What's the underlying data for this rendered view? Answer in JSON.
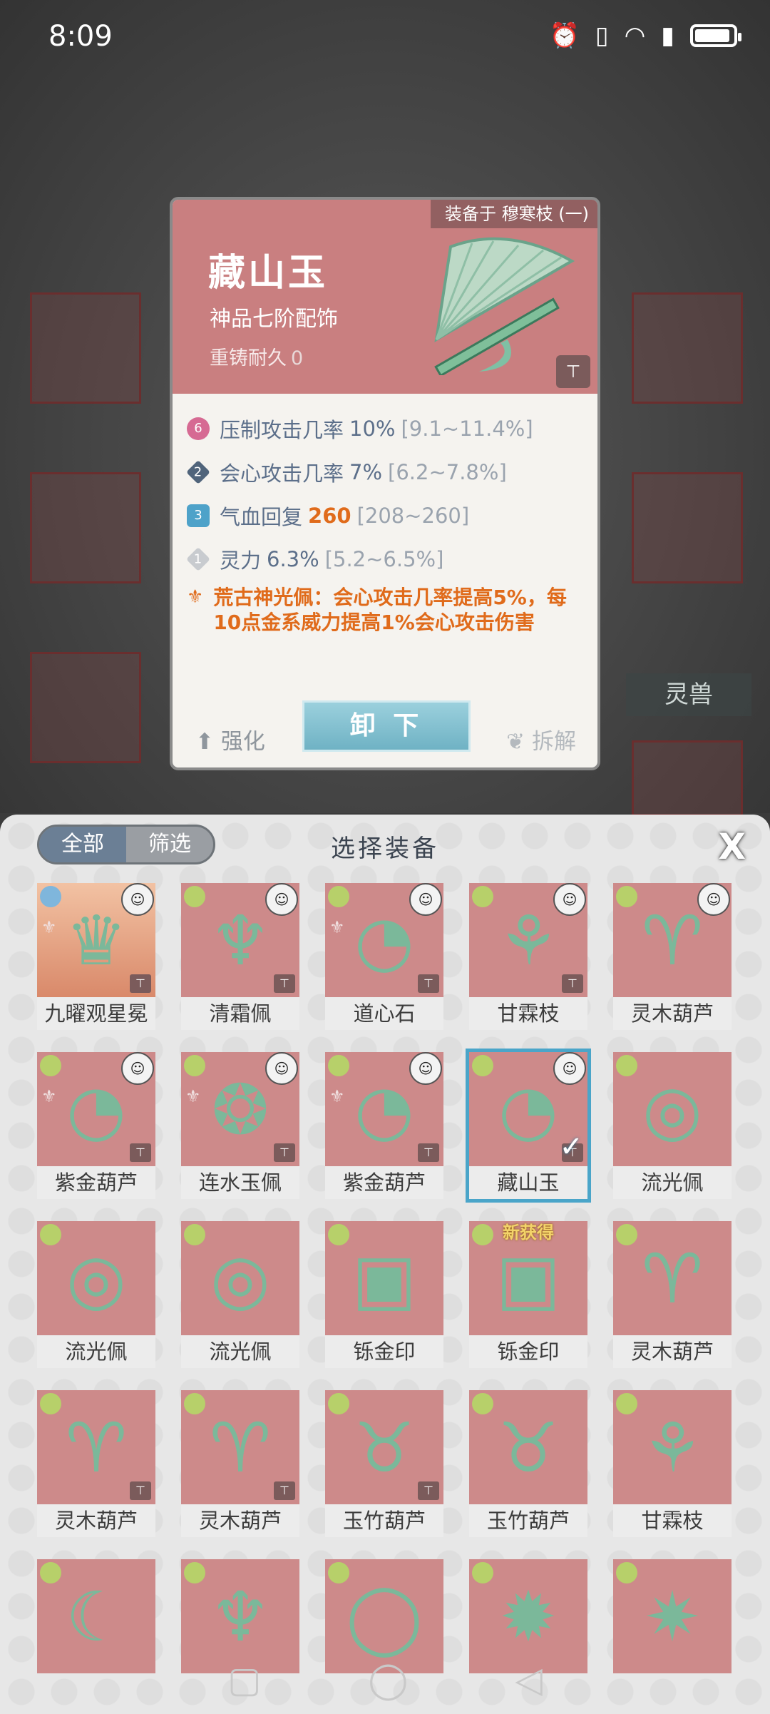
{
  "status_bar": {
    "time": "8:09",
    "icons": [
      "alarm-icon",
      "vibrate-icon",
      "wifi-icon",
      "signal-icon",
      "battery-icon"
    ]
  },
  "background": {
    "side_button": "灵兽"
  },
  "detail": {
    "equipped_on": "装备于 穆寒枝 (一)",
    "name": "藏山玉",
    "grade": "神品七阶配饰",
    "recast_label": "重铸耐久",
    "recast_value": "0",
    "attributes": [
      {
        "badge": "6",
        "name": "压制攻击几率",
        "value": "10%",
        "range": "[9.1~11.4%]",
        "highlight": false,
        "badge_color": "#d66a93"
      },
      {
        "badge": "2",
        "name": "会心攻击几率",
        "value": "7%",
        "range": "[6.2~7.8%]",
        "highlight": false,
        "badge_color": "#50647b"
      },
      {
        "badge": "3",
        "name": "气血回复",
        "value": "260",
        "range": "[208~260]",
        "highlight": true,
        "badge_color": "#4ea2c9"
      },
      {
        "badge": "1",
        "name": "灵力",
        "value": "6.3%",
        "range": "[5.2~6.5%]",
        "highlight": false,
        "badge_color": "#c8cbcf"
      }
    ],
    "skill_text": "荒古神光佩：会心攻击几率提高5%，每10点金系威力提高1%会心攻击伤害",
    "buttons": {
      "strengthen": "强化",
      "unequip": "卸 下",
      "dismantle": "拆解"
    }
  },
  "panel": {
    "tabs": [
      "全部",
      "筛选"
    ],
    "active_tab": 0,
    "title": "选择装备",
    "close": "X",
    "items": [
      {
        "name": "九曜观星冕",
        "style": "orange",
        "element": "blue",
        "hero": true,
        "lock": true,
        "set": true,
        "icon": "crown-icon",
        "glyph": "♛"
      },
      {
        "name": "清霜佩",
        "element": "green",
        "hero": true,
        "lock": true,
        "icon": "jade-pendant-icon",
        "glyph": "♆"
      },
      {
        "name": "道心石",
        "element": "green",
        "hero": true,
        "lock": true,
        "set": true,
        "icon": "fan-icon",
        "glyph": "◔"
      },
      {
        "name": "甘霖枝",
        "element": "green",
        "hero": true,
        "lock": true,
        "icon": "branch-icon",
        "glyph": "⚘"
      },
      {
        "name": "灵木葫芦",
        "element": "green",
        "hero": true,
        "lock": false,
        "icon": "gourd-icon",
        "glyph": "♈"
      },
      {
        "name": "紫金葫芦",
        "element": "green",
        "hero": true,
        "lock": true,
        "set": true,
        "icon": "fan-icon",
        "glyph": "◔"
      },
      {
        "name": "连水玉佩",
        "element": "green",
        "hero": true,
        "lock": true,
        "set": true,
        "icon": "ring-pendant-icon",
        "glyph": "❂"
      },
      {
        "name": "紫金葫芦",
        "element": "green",
        "hero": true,
        "lock": true,
        "set": true,
        "icon": "fan-icon",
        "glyph": "◔"
      },
      {
        "name": "藏山玉",
        "element": "green",
        "hero": true,
        "lock": true,
        "selected": true,
        "icon": "fan-icon",
        "glyph": "◔"
      },
      {
        "name": "流光佩",
        "element": "green",
        "hero": false,
        "lock": false,
        "icon": "spiral-pendant-icon",
        "glyph": "◎"
      },
      {
        "name": "流光佩",
        "element": "green",
        "hero": false,
        "lock": false,
        "icon": "spiral-pendant-icon",
        "glyph": "◎"
      },
      {
        "name": "流光佩",
        "element": "green",
        "hero": false,
        "lock": false,
        "icon": "spiral-pendant-icon",
        "glyph": "◎"
      },
      {
        "name": "铄金印",
        "element": "green",
        "hero": false,
        "lock": false,
        "icon": "seal-icon",
        "glyph": "▣"
      },
      {
        "name": "铄金印",
        "element": "green",
        "hero": false,
        "lock": false,
        "new": "新获得",
        "icon": "seal-icon",
        "glyph": "▣"
      },
      {
        "name": "灵木葫芦",
        "element": "green",
        "hero": false,
        "lock": false,
        "icon": "gourd-icon",
        "glyph": "♈"
      },
      {
        "name": "灵木葫芦",
        "element": "green",
        "hero": false,
        "lock": true,
        "icon": "gourd-icon",
        "glyph": "♈"
      },
      {
        "name": "灵木葫芦",
        "element": "green",
        "hero": false,
        "lock": true,
        "icon": "gourd-icon",
        "glyph": "♈"
      },
      {
        "name": "玉竹葫芦",
        "element": "green",
        "hero": false,
        "lock": true,
        "icon": "green-gourd-icon",
        "glyph": "♉"
      },
      {
        "name": "玉竹葫芦",
        "element": "green",
        "hero": false,
        "lock": false,
        "icon": "green-gourd-icon",
        "glyph": "♉"
      },
      {
        "name": "甘霖枝",
        "element": "green",
        "hero": false,
        "lock": false,
        "icon": "branch-icon",
        "glyph": "⚘"
      },
      {
        "name": "",
        "element": "green",
        "hero": false,
        "lock": false,
        "icon": "jade-ring-icon",
        "glyph": "☾"
      },
      {
        "name": "",
        "element": "green",
        "hero": false,
        "lock": false,
        "icon": "jade-pendant-icon",
        "glyph": "♆"
      },
      {
        "name": "",
        "element": "green",
        "hero": false,
        "lock": false,
        "icon": "mirror-icon",
        "glyph": "◯"
      },
      {
        "name": "",
        "element": "green",
        "hero": false,
        "lock": false,
        "icon": "flame-stone-icon",
        "glyph": "✹"
      },
      {
        "name": "",
        "element": "green",
        "hero": false,
        "lock": false,
        "icon": "flame-crystal-icon",
        "glyph": "✷"
      }
    ]
  },
  "navbar": {
    "icons": [
      "recent-apps-icon",
      "home-icon",
      "back-icon"
    ]
  }
}
